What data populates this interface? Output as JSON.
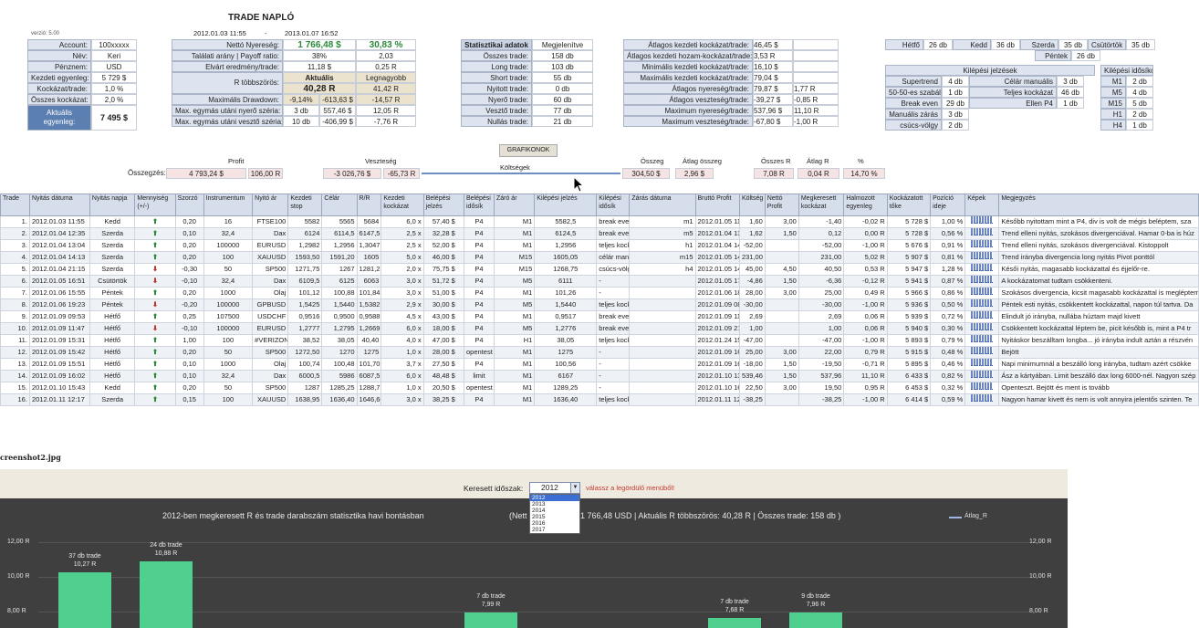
{
  "version": "verzió: 5.00",
  "title": "TRADE NAPLÓ",
  "date_from": "2012.01.03 11:55",
  "date_sep": "-",
  "date_to": "2013.01.07 16:52",
  "account": [
    {
      "label": "Account:",
      "value": "100xxxxx"
    },
    {
      "label": "Név:",
      "value": "Keri"
    },
    {
      "label": "Pénznem:",
      "value": "USD"
    },
    {
      "label": "Kezdeti egyenleg:",
      "value": "5 729 $"
    },
    {
      "label": "Kockázat/trade:",
      "value": "1,0 %"
    },
    {
      "label": "Összes kockázat:",
      "value": "2,0 %"
    }
  ],
  "balance_label": "Aktuális egyenleg:",
  "balance_value": "7 495 $",
  "mid": {
    "net_label": "Nettó Nyereség:",
    "net_value": "1 766,48 $",
    "net_pct": "30,83 %",
    "hit_label": "Találati arány | Payoff ratio:",
    "hit_value": "38%",
    "payoff": "2,03",
    "exp_label": "Elvárt eredmény/trade:",
    "exp_value": "11,18 $",
    "exp_r": "0,25 R",
    "rmult_label": "R többszörös:",
    "act_h": "Aktuális",
    "best_h": "Legnagyobb",
    "act_v": "40,28 R",
    "best_v": "41,42 R",
    "dd_label": "Maximális Drawdown:",
    "dd_pct": "-9,14%",
    "dd_usd": "-613,63 $",
    "dd_r": "-14,57 R",
    "win_label": "Max. egymás utáni nyerő széria:",
    "win_n": "3 db",
    "win_usd": "557,46 $",
    "win_r": "12,05 R",
    "loss_label": "Max. egymás utáni vesztő széria:",
    "loss_n": "10 db",
    "loss_usd": "-406,99 $",
    "loss_r": "-7,76 R"
  },
  "stats_head": "Statisztikai adatok",
  "stats_btn": "Megjelenítve",
  "stats": [
    {
      "label": "Összes trade:",
      "value": "158 db"
    },
    {
      "label": "Long trade:",
      "value": "103 db"
    },
    {
      "label": "Short trade:",
      "value": "55 db"
    },
    {
      "label": "Nyitott trade:",
      "value": "0 db"
    },
    {
      "label": "Nyerő trade:",
      "value": "60 db"
    },
    {
      "label": "Vesztő trade:",
      "value": "77 db"
    },
    {
      "label": "Nullás trade:",
      "value": "21 db"
    }
  ],
  "grafikonok": "GRAFIKONOK",
  "risk": [
    {
      "label": "Átlagos kezdeti kockázat/trade:",
      "value": "46,45 $",
      "r": ""
    },
    {
      "label": "Átlagos kezdeti hozam-kockázat/trade:",
      "value": "3,53 R",
      "r": ""
    },
    {
      "label": "Minimális kezdeti kockázat/trade:",
      "value": "16,10 $",
      "r": ""
    },
    {
      "label": "Maximális kezdeti kockázat/trade:",
      "value": "79,04 $",
      "r": ""
    },
    {
      "label": "Átlagos nyereség/trade:",
      "value": "79,87 $",
      "r": "1,77 R"
    },
    {
      "label": "Átlagos veszteség/trade:",
      "value": "-39,27 $",
      "r": "-0,85 R"
    },
    {
      "label": "Maximum nyereség/trade:",
      "value": "537,96 $",
      "r": "11,10 R"
    },
    {
      "label": "Maximum veszteség/trade:",
      "value": "-67,80 $",
      "r": "-1,00 R"
    }
  ],
  "days": [
    {
      "d": "Hétfő",
      "v": "26 db"
    },
    {
      "d": "Kedd",
      "v": "36 db"
    },
    {
      "d": "Szerda",
      "v": "35 db"
    },
    {
      "d": "Csütörtök",
      "v": "35 db"
    }
  ],
  "friday": {
    "d": "Péntek",
    "v": "26 db"
  },
  "exit_head": "Kilépési jelzések",
  "exit_tf_head": "Kilépési idősíkok",
  "exits": [
    {
      "a": "Supertrend",
      "av": "4 db",
      "b": "Célár manuális",
      "bv": "3 db",
      "t": "M1",
      "tv": "2 db"
    },
    {
      "a": "50-50-es szabály",
      "av": "1 db",
      "b": "Teljes kockázat",
      "bv": "46 db",
      "t": "M5",
      "tv": "4 db"
    },
    {
      "a": "Break even",
      "av": "29 db",
      "b": "Ellen P4",
      "bv": "1 db",
      "t": "M15",
      "tv": "5 db"
    },
    {
      "a": "Manuális zárás",
      "av": "3 db",
      "b": "",
      "bv": "",
      "t": "H1",
      "tv": "2 db"
    },
    {
      "a": "csúcs-völgy",
      "av": "2 db",
      "b": "",
      "bv": "",
      "t": "H4",
      "tv": "1 db"
    }
  ],
  "summary": {
    "label": "Összegzés:",
    "profit_h": "Profit",
    "loss_h": "Veszteség",
    "cost_h": "Költségek",
    "profit": "4 793,24 $",
    "profit_r": "106,00 R",
    "loss": "-3 026,76 $",
    "loss_r": "-65,73 R",
    "sum_h": "Összeg",
    "avg_h": "Átlag összeg",
    "sumr_h": "Összes R",
    "avgr_h": "Átlag R",
    "pct_h": "%",
    "sum": "304,50 $",
    "avg": "2,96 $",
    "sumr": "7,08 R",
    "avgr": "0,04 R",
    "pct": "14,70 %"
  },
  "columns": [
    "Trade",
    "Nyitás dátuma",
    "Nyitás napja",
    "Mennyiség (+/-)",
    "Szorzó",
    "Instrumentum",
    "Nyitó ár",
    "Kezdeti stop",
    "Célár",
    "R/R",
    "Kezdeti kockázat",
    "Belépési jelzés",
    "Belépési idősík",
    "Záró ár",
    "Kilépési jelzés",
    "Kilépési idősík",
    "Zárás dátuma",
    "Bruttó Profit",
    "Költség",
    "Nettó Profit",
    "Megkeresett kockázat",
    "Halmozott egyenleg",
    "Kockázatott tőke",
    "Pozíció ideje",
    "Képek",
    "Megjegyzés"
  ],
  "rows": [
    [
      "1.",
      "2012.01.03 11:55",
      "Kedd",
      "up",
      "0,20",
      "16",
      "FTSE100",
      "5582",
      "5565",
      "5684",
      "6,0 x",
      "57,40 $",
      "P4",
      "M1",
      "5582,5",
      "break even",
      "m1",
      "2012.01.05 11:56",
      "1,60",
      "3,00",
      "-1,40",
      "-0,02 R",
      "5 728 $",
      "1,00 %",
      "48:01",
      "Később nyitottam mint a P4, div is volt de mégis beléptem, sza"
    ],
    [
      "2.",
      "2012.01.04 12:35",
      "Szerda",
      "up",
      "0,10",
      "32,4",
      "Dax",
      "6124",
      "6114,5",
      "6147,5",
      "2,5 x",
      "32,28 $",
      "P4",
      "M1",
      "6124,5",
      "break even",
      "m5",
      "2012.01.04 13:00",
      "1,62",
      "1,50",
      "0,12",
      "0,00 R",
      "5 728 $",
      "0,56 %",
      "0:25",
      "Trend elleni nyitás, szokásos divergenciával. Hamar 0-ba is húz"
    ],
    [
      "3.",
      "2012.01.04 13:04",
      "Szerda",
      "up",
      "0,20",
      "100000",
      "EURUSD",
      "1,2982",
      "1,2956",
      "1,3047",
      "2,5 x",
      "52,00 $",
      "P4",
      "M1",
      "1,2956",
      "teljes kockázat",
      "h1",
      "2012.01.04 14:05",
      "-52,00",
      "",
      "-52,00",
      "-1,00 R",
      "5 676 $",
      "0,91 %",
      "1:01",
      "Trend elleni nyitás, szokásos divergenciával. Kistoppolt"
    ],
    [
      "4.",
      "2012.01.04 14:13",
      "Szerda",
      "up",
      "0,20",
      "100",
      "XAUUSD",
      "1593,50",
      "1591,20",
      "1605",
      "5,0 x",
      "46,00 $",
      "P4",
      "M15",
      "1605,05",
      "célár manuális",
      "m15",
      "2012.01.05 14:15",
      "231,00",
      "",
      "231,00",
      "5,02 R",
      "5 907 $",
      "0,81 %",
      "24:02",
      "Trend irányba divergencia long nyitás Pivot ponttól"
    ],
    [
      "5.",
      "2012.01.04 21:15",
      "Szerda",
      "dn",
      "-0,30",
      "50",
      "SP500",
      "1271,75",
      "1267",
      "1281,25",
      "2,0 x",
      "75,75 $",
      "P4",
      "M15",
      "1268,75",
      "csúcs-völgy",
      "h4",
      "2012.01.05 14:15",
      "45,00",
      "4,50",
      "40,50",
      "0,53 R",
      "5 947 $",
      "1,28 %",
      "17:00",
      "Késői nyitás, magasabb kockázattal és éjjelőr-re."
    ],
    [
      "6.",
      "2012.01.05 16:51",
      "Csütörtök",
      "dn",
      "-0,10",
      "32,4",
      "Dax",
      "6109,5",
      "6125",
      "6063",
      "3,0 x",
      "51,72 $",
      "P4",
      "M5",
      "6111",
      "-",
      "",
      "2012.01.05 17:30",
      "-4,86",
      "1,50",
      "-6,36",
      "-0,12 R",
      "5 941 $",
      "0,87 %",
      "1:09",
      "A kockázatomat tudtam csökkenteni."
    ],
    [
      "7.",
      "2012.01.06 15:55",
      "Péntek",
      "up",
      "0,20",
      "1000",
      "Olaj",
      "101,12",
      "100,88",
      "101,84",
      "3,0 x",
      "51,00 $",
      "P4",
      "M1",
      "101,26",
      "-",
      "",
      "2012.01.06 18:34",
      "28,00",
      "3,00",
      "25,00",
      "0,49 R",
      "5 966 $",
      "0,86 %",
      "2:39",
      "Szokásos divergencia, kicsit magasabb kockázattal is megléptem"
    ],
    [
      "8.",
      "2012.01.06 19:23",
      "Péntek",
      "dn",
      "-0,20",
      "100000",
      "GPBUSD",
      "1,5425",
      "1,5440",
      "1,5382",
      "2,9 x",
      "30,00 $",
      "P4",
      "M5",
      "1,5440",
      "teljes kockázat",
      "",
      "2012.01.09 08:33",
      "-30,00",
      "",
      "-30,00",
      "-1,00 R",
      "5 936 $",
      "0,50 %",
      "61:10",
      "Péntek esti nyitás, csökkentett kockázattal, napon túl tartva. Da"
    ],
    [
      "9.",
      "2012.01.09 09:53",
      "Hétfő",
      "up",
      "0,25",
      "107500",
      "USDCHF",
      "0,9516",
      "0,9500",
      "0,9588",
      "4,5 x",
      "43,00 $",
      "P4",
      "M1",
      "0,9517",
      "break even",
      "",
      "2012.01.09 11:05",
      "2,69",
      "",
      "2,69",
      "0,06 R",
      "5 939 $",
      "0,72 %",
      "1:12",
      "Elindult jó irányba, nullába húztam majd kivett"
    ],
    [
      "10.",
      "2012.01.09 11:47",
      "Hétfő",
      "dn",
      "-0,10",
      "100000",
      "EURUSD",
      "1,2777",
      "1,2795",
      "1,2669",
      "6,0 x",
      "18,00 $",
      "P4",
      "M5",
      "1,2776",
      "break even",
      "",
      "2012.01.09 21:42",
      "1,00",
      "",
      "1,00",
      "0,06 R",
      "5 940 $",
      "0,30 %",
      "9:55",
      "Csökkentett kockázattal léptem be, picit később is, mint a P4 tr"
    ],
    [
      "11.",
      "2012.01.09 15:31",
      "Hétfő",
      "up",
      "1,00",
      "100",
      "#VERIZON",
      "38,52",
      "38,05",
      "40,40",
      "4,0 x",
      "47,00 $",
      "P4",
      "H1",
      "38,05",
      "teljes kockázat",
      "",
      "2012.01.24 15:30",
      "-47,00",
      "",
      "-47,00",
      "-1,00 R",
      "5 893 $",
      "0,79 %",
      "359:59",
      "Nyitáskor beszálltam longba... jó irányba indult aztán a részvén"
    ],
    [
      "12.",
      "2012.01.09 15:42",
      "Hétfő",
      "up",
      "0,20",
      "50",
      "SP500",
      "1272,50",
      "1270",
      "1275",
      "1,0 x",
      "28,00 $",
      "opentest",
      "M1",
      "1275",
      "-",
      "",
      "2012.01.09 16:15",
      "25,00",
      "3,00",
      "22,00",
      "0,79 R",
      "5 915 $",
      "0,48 %",
      "0:33",
      "Bejött"
    ],
    [
      "13.",
      "2012.01.09 15:51",
      "Hétfő",
      "up",
      "0,10",
      "1000",
      "Olaj",
      "100,74",
      "100,48",
      "101,70",
      "3,7 x",
      "27,50 $",
      "P4",
      "M1",
      "100,56",
      "-",
      "",
      "2012.01.09 16:51",
      "-18,00",
      "1,50",
      "-19,50",
      "-0,71 R",
      "5 895 $",
      "0,46 %",
      "1:00",
      "Napi minimumnál a beszálló long irányba, tudtam azért csökke"
    ],
    [
      "14.",
      "2012.01.09 16:02",
      "Hétfő",
      "up",
      "0,10",
      "32,4",
      "Dax",
      "6000,5",
      "5986",
      "6087,5",
      "6,0 x",
      "48,48 $",
      "limit",
      "M1",
      "6167",
      "-",
      "",
      "2012.01.10 13:01",
      "539,46",
      "1,50",
      "537,96",
      "11,10 R",
      "6 433 $",
      "0,82 %",
      "20:59",
      "Ász a kártyában. Limit beszálló dax long 6000-nél. Nagyon szép"
    ],
    [
      "15.",
      "2012.01.10 15:43",
      "Kedd",
      "up",
      "0,20",
      "50",
      "SP500",
      "1287",
      "1285,25",
      "1288,75",
      "1,0 x",
      "20,50 $",
      "opentest",
      "M1",
      "1289,25",
      "-",
      "",
      "2012.01.10 16:01",
      "22,50",
      "3,00",
      "19,50",
      "0,95 R",
      "6 453 $",
      "0,32 %",
      "0:18",
      "Openteszt. Bejött és ment is tovább"
    ],
    [
      "16.",
      "2012.01.11 12:17",
      "Szerda",
      "up",
      "0,15",
      "100",
      "XAUUSD",
      "1638,95",
      "1636,40",
      "1646,60",
      "3,0 x",
      "38,25 $",
      "P4",
      "M1",
      "1636,40",
      "teljes kockázat",
      "",
      "2012.01.11 12:19",
      "-38,25",
      "",
      "-38,25",
      "-1,00 R",
      "6 414 $",
      "0,59 %",
      "0:02",
      "Nagyon hamar kivett és nem is volt annyira jelentős szinten. Te"
    ]
  ],
  "screenshot_label": "creenshot2.jpg",
  "filter_label": "Keresett időszak:",
  "filter_value": "2012",
  "filter_hint": "válassz a legördülő menüből!",
  "filter_options": [
    "2012",
    "2013",
    "2014",
    "2015",
    "2016",
    "2017"
  ],
  "chart_data": {
    "type": "bar",
    "title": "2012-ben megkeresett R és trade darabszám statisztika havi bontásban",
    "subtitle_prefix": "(Nett",
    "subtitle": "1 766,48 USD  |  Aktuális R többszörös: 40,28 R  |  Összes trade: 158 db )",
    "legend": "Átlag_R",
    "yticks": [
      "12,00 R",
      "10,00 R",
      "8,00 R"
    ],
    "ylim": [
      7.5,
      12.5
    ],
    "bars": [
      {
        "trades": "37 db trade",
        "value": 10.27,
        "label": "10,27 R"
      },
      {
        "trades": "24 db trade",
        "value": 10.88,
        "label": "10,88 R"
      },
      {
        "trades": "",
        "value": null,
        "label": ""
      },
      {
        "trades": "",
        "value": null,
        "label": ""
      },
      {
        "trades": "",
        "value": null,
        "label": ""
      },
      {
        "trades": "7 db trade",
        "value": 7.99,
        "label": "7,99 R"
      },
      {
        "trades": "",
        "value": null,
        "label": ""
      },
      {
        "trades": "",
        "value": null,
        "label": ""
      },
      {
        "trades": "7 db trade",
        "value": 7.68,
        "label": "7,68 R"
      },
      {
        "trades": "9 db trade",
        "value": 7.96,
        "label": "7,96 R"
      }
    ]
  }
}
